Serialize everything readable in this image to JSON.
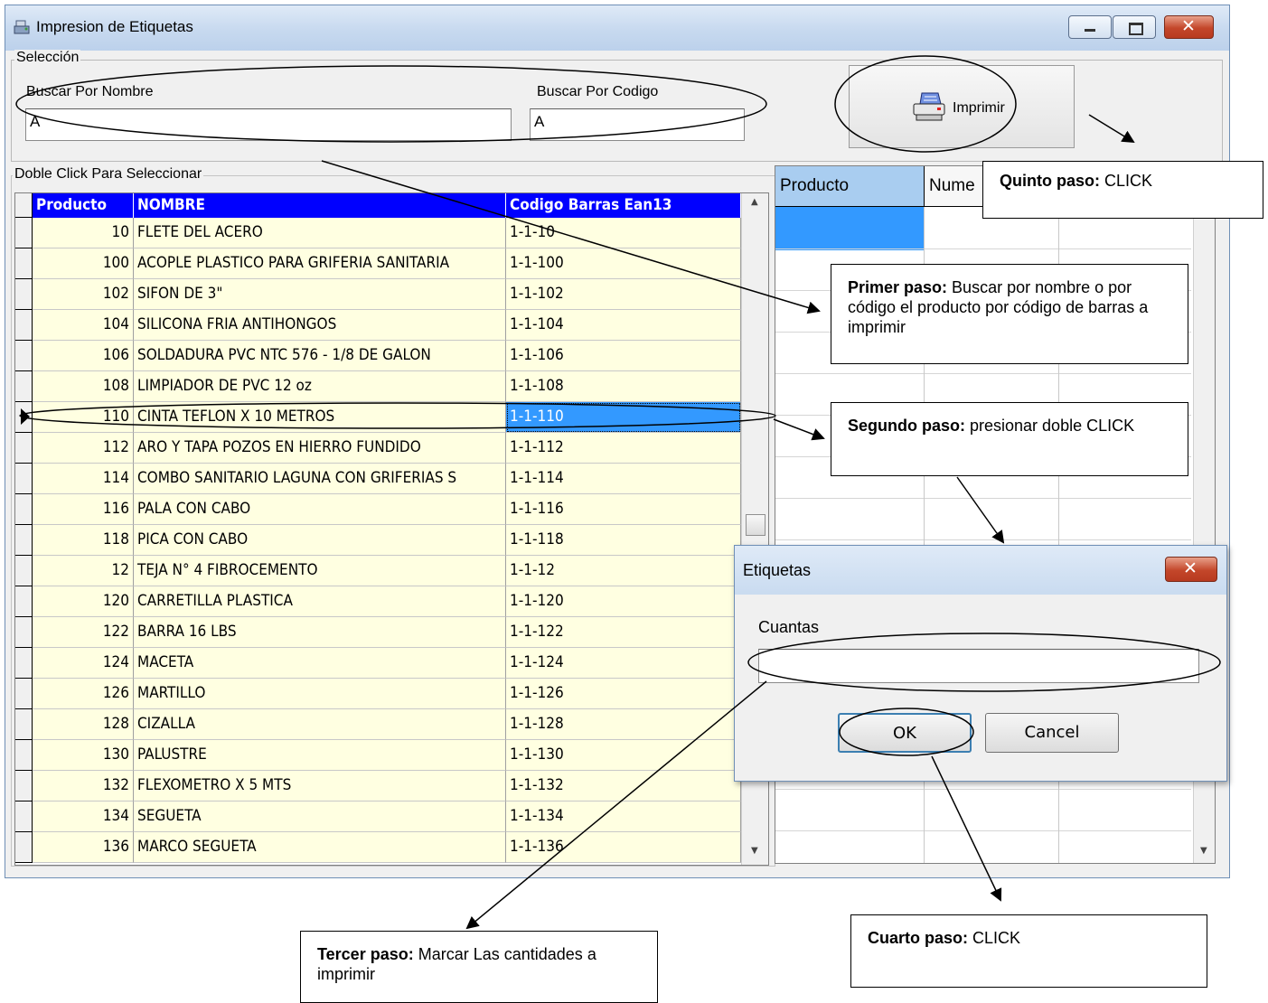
{
  "window": {
    "title": "Impresion de Etiquetas"
  },
  "seleccion": {
    "legend": "Selección",
    "search_name_label": "Buscar Por Nombre",
    "search_name_value": "A",
    "search_code_label": "Buscar Por Codigo",
    "search_code_value": "A",
    "print_label": "Imprimir"
  },
  "grid": {
    "legend": "Doble Click Para Seleccionar",
    "headers": [
      "Producto",
      "NOMBRE",
      "Codigo Barras Ean13"
    ],
    "rows": [
      {
        "producto": "10",
        "nombre": "FLETE DEL ACERO",
        "codigo": "1-1-10"
      },
      {
        "producto": "100",
        "nombre": "ACOPLE PLASTICO PARA GRIFERIA SANITARIA",
        "codigo": "1-1-100"
      },
      {
        "producto": "102",
        "nombre": "SIFON DE 3\"",
        "codigo": "1-1-102"
      },
      {
        "producto": "104",
        "nombre": "SILICONA FRIA ANTIHONGOS",
        "codigo": "1-1-104"
      },
      {
        "producto": "106",
        "nombre": "SOLDADURA PVC NTC 576 - 1/8 DE GALON",
        "codigo": "1-1-106"
      },
      {
        "producto": "108",
        "nombre": "LIMPIADOR DE PVC 12 oz",
        "codigo": "1-1-108"
      },
      {
        "producto": "110",
        "nombre": "CINTA TEFLON X 10 METROS",
        "codigo": "1-1-110"
      },
      {
        "producto": "112",
        "nombre": "ARO Y TAPA POZOS EN HIERRO FUNDIDO",
        "codigo": "1-1-112"
      },
      {
        "producto": "114",
        "nombre": "COMBO SANITARIO LAGUNA CON GRIFERIAS S",
        "codigo": "1-1-114"
      },
      {
        "producto": "116",
        "nombre": "PALA CON CABO",
        "codigo": "1-1-116"
      },
      {
        "producto": "118",
        "nombre": "PICA CON CABO",
        "codigo": "1-1-118"
      },
      {
        "producto": "12",
        "nombre": "TEJA N° 4 FIBROCEMENTO",
        "codigo": "1-1-12"
      },
      {
        "producto": "120",
        "nombre": "CARRETILLA PLASTICA",
        "codigo": "1-1-120"
      },
      {
        "producto": "122",
        "nombre": "BARRA 16 LBS",
        "codigo": "1-1-122"
      },
      {
        "producto": "124",
        "nombre": "MACETA",
        "codigo": "1-1-124"
      },
      {
        "producto": "126",
        "nombre": "MARTILLO",
        "codigo": "1-1-126"
      },
      {
        "producto": "128",
        "nombre": "CIZALLA",
        "codigo": "1-1-128"
      },
      {
        "producto": "130",
        "nombre": "PALUSTRE",
        "codigo": "1-1-130"
      },
      {
        "producto": "132",
        "nombre": "FLEXOMETRO X 5 MTS",
        "codigo": "1-1-132"
      },
      {
        "producto": "134",
        "nombre": "SEGUETA",
        "codigo": "1-1-134"
      },
      {
        "producto": "136",
        "nombre": "MARCO SEGUETA",
        "codigo": "1-1-136"
      }
    ]
  },
  "right_grid": {
    "headers": [
      "Producto",
      "Nume"
    ]
  },
  "dialog": {
    "title": "Etiquetas",
    "label": "Cuantas",
    "value": "",
    "ok": "OK",
    "cancel": "Cancel"
  },
  "notes": {
    "quinto": {
      "bold": "Quinto  paso:",
      "text": " CLICK"
    },
    "primero": {
      "bold": "Primer paso:",
      "text": " Buscar por nombre o por código el producto por código de barras a imprimir"
    },
    "segundo": {
      "bold": "Segundo  paso:",
      "text": " presionar doble CLICK"
    },
    "tercero": {
      "bold": "Tercer  paso:",
      "text": " Marcar Las cantidades a imprimir"
    },
    "cuarto": {
      "bold": "Cuarto  paso:",
      "text": " CLICK"
    }
  },
  "colors": {
    "grid_header": "#0000ff",
    "grid_row_bg": "#ffffe1",
    "selection": "#3399ff",
    "right_header": "#a9cdf0"
  }
}
